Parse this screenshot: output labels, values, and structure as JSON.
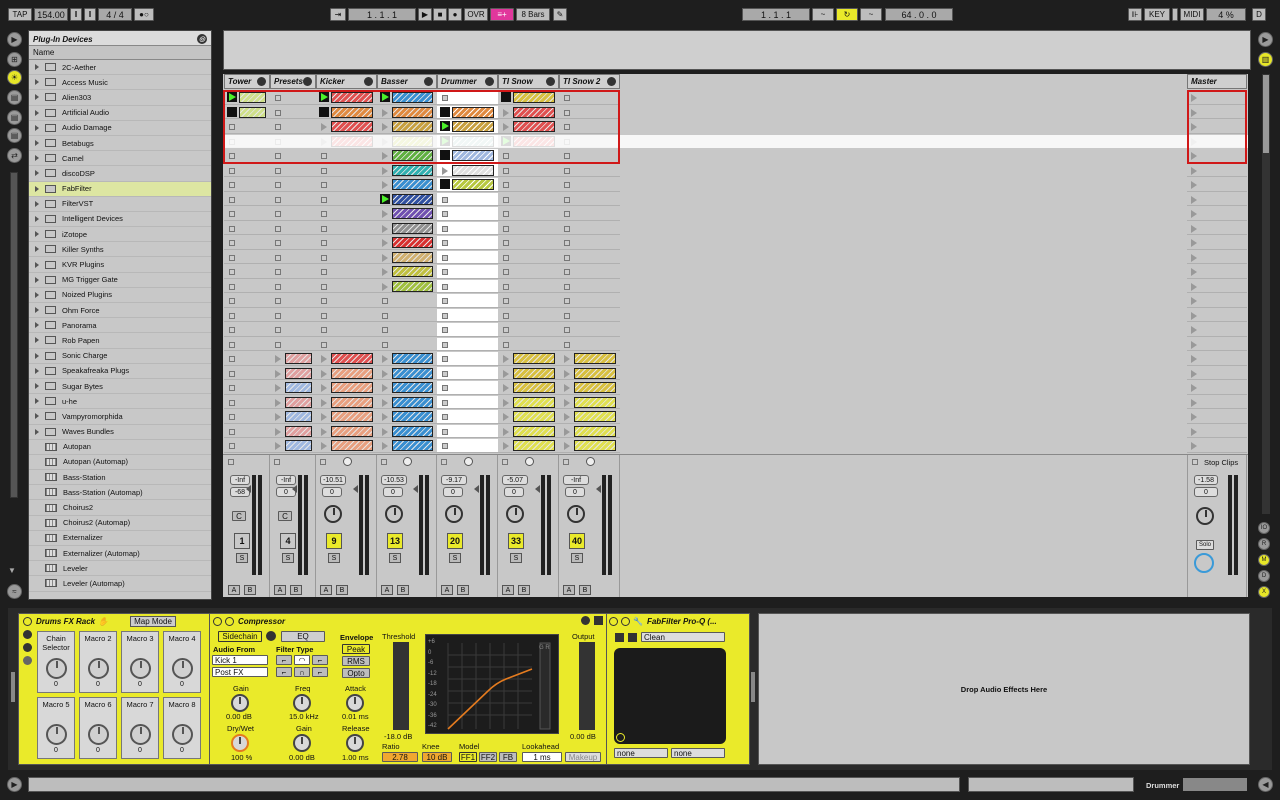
{
  "transport": {
    "tap": "TAP",
    "tempo": "154.00",
    "sig": "4 / 4",
    "position": "1 .  1 .  1",
    "ovr": "OVR",
    "quantize": "8 Bars",
    "loop_start": "1 .  1 .  1",
    "loop_len": "64 .  0 .  0",
    "key": "KEY",
    "midi": "MIDI",
    "cpu": "4 %",
    "disk": "D"
  },
  "browser": {
    "title": "Plug-In Devices",
    "col": "Name",
    "folders": [
      "2C-Aether",
      "Access Music",
      "Alien303",
      "Artificial Audio",
      "Audio Damage",
      "Betabugs",
      "Camel",
      "discoDSP",
      "FabFilter",
      "FilterVST",
      "Intelligent Devices",
      "iZotope",
      "Killer Synths",
      "KVR Plugins",
      "MG Trigger Gate",
      "Noized Plugins",
      "Ohm Force",
      "Panorama",
      "Rob Papen",
      "Sonic Charge",
      "Speakafreaka Plugs",
      "Sugar Bytes",
      "u-he",
      "Vampyromorphida",
      "Waves Bundles"
    ],
    "devices": [
      "Autopan",
      "Autopan (Automap)",
      "Bass-Station",
      "Bass-Station (Automap)",
      "Choirus2",
      "Choirus2 (Automap)",
      "Externalizer",
      "Externalizer (Automap)",
      "Leveler",
      "Leveler (Automap)"
    ]
  },
  "tracks": [
    {
      "name": "Tower",
      "vol": "-Inf",
      "pan": "-68",
      "num": "1",
      "cross": "C"
    },
    {
      "name": "Presets",
      "vol": "-Inf",
      "pan": "0",
      "num": "4",
      "cross": "C"
    },
    {
      "name": "Kicker",
      "vol": "-10.51",
      "pan": "0",
      "num": "9"
    },
    {
      "name": "Basser",
      "vol": "-10.53",
      "pan": "0",
      "num": "13"
    },
    {
      "name": "Drummer",
      "vol": "-9.17",
      "pan": "0",
      "num": "20"
    },
    {
      "name": "TI Snow",
      "vol": "-5.07",
      "pan": "0",
      "num": "33"
    },
    {
      "name": "TI Snow 2",
      "vol": "-Inf",
      "pan": "0",
      "num": "40"
    }
  ],
  "master": {
    "name": "Master",
    "vol": "-1.58",
    "pan": "0",
    "stop": "Stop Clips",
    "solo": "Solo"
  },
  "solo_label": "S",
  "a_label": "A",
  "b_label": "B",
  "rack": {
    "title": "Drums FX Rack",
    "mapmode": "Map Mode",
    "macros": [
      {
        "l": "Chain Selector",
        "v": "0"
      },
      {
        "l": "Macro 2",
        "v": "0"
      },
      {
        "l": "Macro 3",
        "v": "0"
      },
      {
        "l": "Macro 4",
        "v": "0"
      },
      {
        "l": "Macro 5",
        "v": "0"
      },
      {
        "l": "Macro 6",
        "v": "0"
      },
      {
        "l": "Macro 7",
        "v": "0"
      },
      {
        "l": "Macro 8",
        "v": "0"
      }
    ]
  },
  "comp": {
    "title": "Compressor",
    "sidechain": "Sidechain",
    "eq": "EQ",
    "audio_from": "Audio From",
    "source": "Kick 1",
    "post": "Post FX",
    "gain": "Gain",
    "gain_v": "0.00 dB",
    "drywet": "Dry/Wet",
    "drywet_v": "100 %",
    "filter": "Filter Type",
    "freq": "Freq",
    "freq_v": "15.0 kHz",
    "fgain": "Gain",
    "fgain_v": "0.00 dB",
    "envelope": "Envelope",
    "peak": "Peak",
    "rms": "RMS",
    "opto": "Opto",
    "attack": "Attack",
    "attack_v": "0.01 ms",
    "release": "Release",
    "release_v": "1.00 ms",
    "threshold": "Threshold",
    "thr_v": "-18.0 dB",
    "ratio": "Ratio",
    "ratio_v": "2.78",
    "knee": "Knee",
    "knee_v": "10 dB",
    "model": "Model",
    "ff1": "FF1",
    "ff2": "FF2",
    "fb": "FB",
    "lookahead": "Lookahead",
    "look_v": "1 ms",
    "makeup": "Makeup",
    "output": "Output",
    "out_v": "0.00 dB",
    "gr": "G R",
    "scale": [
      "+6",
      "0",
      "-6",
      "-12",
      "-18",
      "-24",
      "-30",
      "-36",
      "-42"
    ]
  },
  "proq": {
    "title": "FabFilter Pro-Q (...",
    "preset": "Clean",
    "none1": "none",
    "none2": "none"
  },
  "drop": "Drop Audio Effects Here",
  "status": {
    "track": "Drummer"
  },
  "colors": {
    "accent": "#eaea2a",
    "pink": "#e1379c",
    "play": "#4cf02a"
  }
}
